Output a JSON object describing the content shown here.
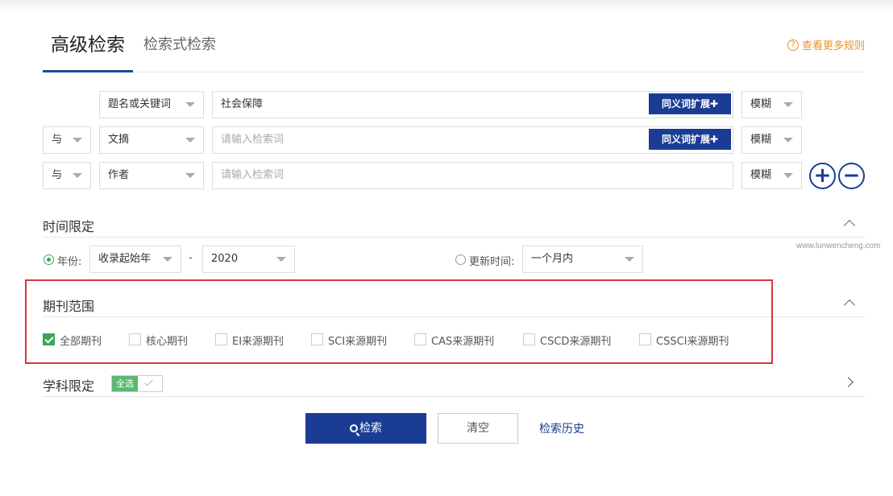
{
  "tabs": {
    "active": "高级检索",
    "other": "检索式检索"
  },
  "rules_link": {
    "icon": "?",
    "label": "查看更多规则"
  },
  "search_rows": [
    {
      "field": "题名或关键词",
      "term": "社会保障",
      "synonym": "同义词扩展✚",
      "match": "模糊"
    },
    {
      "logic": "与",
      "field": "文摘",
      "placeholder": "请输入检索词",
      "synonym": "同义词扩展✚",
      "match": "模糊"
    },
    {
      "logic": "与",
      "field": "作者",
      "placeholder": "请输入检索词",
      "match": "模糊"
    }
  ],
  "add_row": "+",
  "remove_row": "−",
  "time_section": {
    "title": "时间限定",
    "year_label": "年份:",
    "year_start": "收录起始年",
    "dash": "-",
    "year_end": "2020",
    "update_label": "更新时间:",
    "update_value": "一个月内"
  },
  "watermark": "www.lunwencheng.com",
  "journal_section": {
    "title": "期刊范围",
    "options": [
      {
        "label": "全部期刊",
        "checked": true
      },
      {
        "label": "核心期刊",
        "checked": false
      },
      {
        "label": "EI来源期刊",
        "checked": false
      },
      {
        "label": "SCI来源期刊",
        "checked": false
      },
      {
        "label": "CAS来源期刊",
        "checked": false
      },
      {
        "label": "CSCD来源期刊",
        "checked": false
      },
      {
        "label": "CSSCI来源期刊",
        "checked": false
      }
    ]
  },
  "subject_section": {
    "title": "学科限定",
    "select_all": "全选"
  },
  "actions": {
    "search": "检索",
    "clear": "清空",
    "history": "检索历史"
  },
  "colors": {
    "primary": "#1b3c95",
    "accent_green": "#3aa655",
    "highlight_red": "#d8363a",
    "link_orange": "#e8922a"
  }
}
